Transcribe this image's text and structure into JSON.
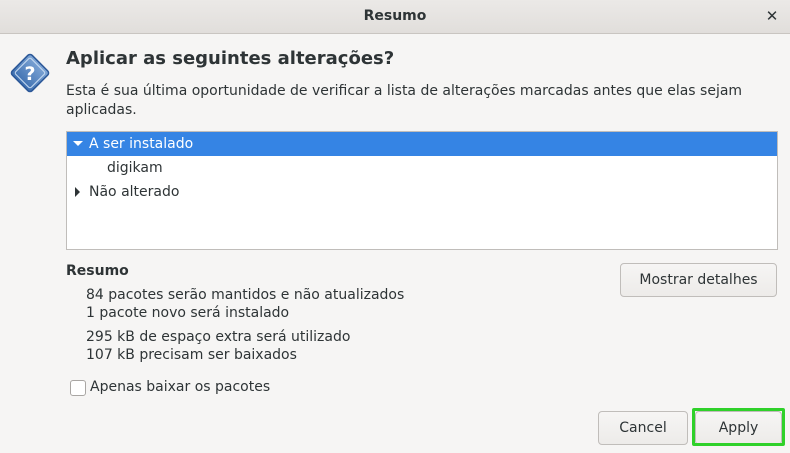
{
  "window": {
    "title": "Resumo",
    "close_glyph": "✕"
  },
  "dialog": {
    "icon": "question-icon",
    "heading": "Aplicar as seguintes alterações?",
    "description": "Esta é sua última oportunidade de verificar a lista de alterações marcadas antes que elas sejam aplicadas."
  },
  "changes_tree": {
    "rows": [
      {
        "label": "A ser instalado",
        "expanded": true,
        "selected": true
      },
      {
        "label": "digikam",
        "child": true
      },
      {
        "label": "Não alterado",
        "expanded": false,
        "selected": false
      }
    ]
  },
  "summary": {
    "title": "Resumo",
    "lines": [
      "84 pacotes serão mantidos e não atualizados",
      "1 pacote novo será instalado",
      "295 kB de espaço extra será utilizado",
      "107 kB precisam ser baixados"
    ],
    "details_button": "Mostrar detalhes"
  },
  "options": {
    "download_only_label": "Apenas baixar os pacotes",
    "download_only_checked": false
  },
  "actions": {
    "cancel_label": "Cancel",
    "apply_label": "Apply",
    "highlight_color": "#2fd12a"
  },
  "colors": {
    "selection": "#3584e4",
    "window_bg": "#f6f5f4"
  }
}
